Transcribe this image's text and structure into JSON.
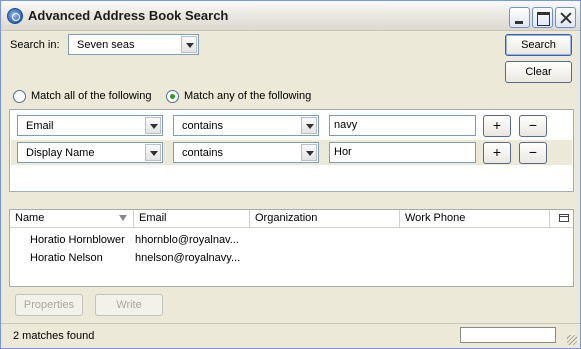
{
  "window": {
    "title": "Advanced Address Book Search"
  },
  "search_in": {
    "label": "Search in:",
    "value": "Seven seas"
  },
  "buttons": {
    "search": "Search",
    "clear": "Clear",
    "properties": "Properties",
    "write": "Write"
  },
  "match": {
    "all_label": "Match all of the following",
    "any_label": "Match any of the following",
    "selected": "any"
  },
  "criteria": [
    {
      "field": "Email",
      "operator": "contains",
      "value": "navy",
      "add": "+",
      "remove": "−"
    },
    {
      "field": "Display Name",
      "operator": "contains",
      "value": "Hor",
      "add": "+",
      "remove": "−"
    }
  ],
  "results": {
    "columns": [
      "Name",
      "Email",
      "Organization",
      "Work Phone"
    ],
    "rows": [
      {
        "name": "Horatio Hornblower",
        "email": "hhornblo@royalnav...",
        "organization": "",
        "work_phone": ""
      },
      {
        "name": "Horatio Nelson",
        "email": "hnelson@royalnavy...",
        "organization": "",
        "work_phone": ""
      }
    ]
  },
  "status": {
    "text": "2 matches found"
  }
}
